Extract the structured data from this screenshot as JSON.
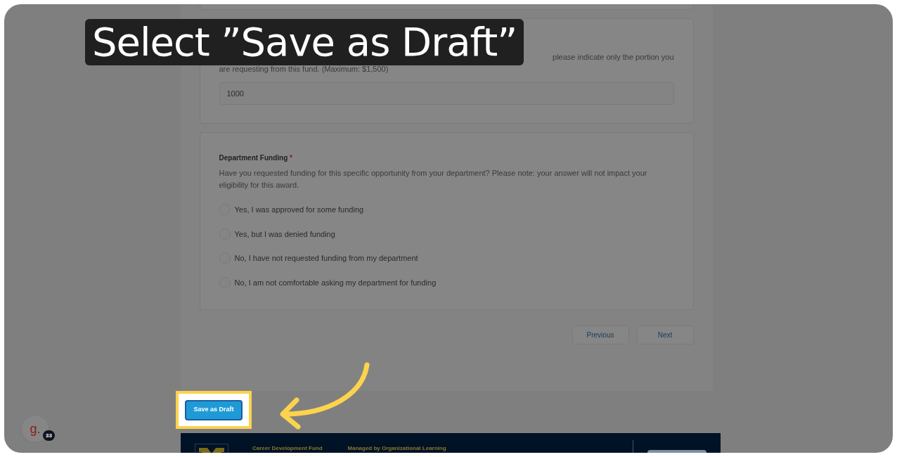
{
  "caption": "Select ”Save as Draft”",
  "funding_card": {
    "description_fragment": "please indicate only the portion you",
    "description_line_2": "are requesting from this fund. (Maximum: $1,500)",
    "value": "1000"
  },
  "department_card": {
    "label": "Department Funding",
    "required_mark": "*",
    "description": "Have you requested funding for this specific opportunity from your department? Please note: your answer will not impact your eligibility for this award.",
    "options": [
      {
        "label": "Yes, I was approved for some funding",
        "selected": false
      },
      {
        "label": "Yes, but I was denied funding",
        "selected": false
      },
      {
        "label": "No, I have not requested funding from my department",
        "selected": false
      },
      {
        "label": "No, I am not comfortable asking my department for funding",
        "selected": false
      }
    ]
  },
  "nav_buttons": [
    "Previous",
    "Next"
  ],
  "save_button": {
    "label": "Save as Draft",
    "highlighted": true
  },
  "footer": {
    "title": "Career Development Fund",
    "managed_by": "Managed by Organizational Learning"
  },
  "assistant": {
    "logo": "g.",
    "count": "33"
  }
}
